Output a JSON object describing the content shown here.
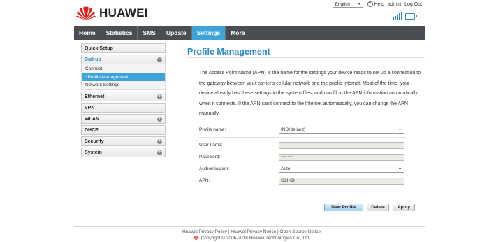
{
  "brand": {
    "name": "HUAWEI",
    "accent": "#2a8bc7",
    "nav_active": "#3ea3d8",
    "logo_color": "#e02020"
  },
  "toplinks": {
    "language": "English",
    "help": "Help",
    "user": "admin",
    "logout": "Log Out"
  },
  "nav": [
    {
      "label": "Home"
    },
    {
      "label": "Statistics"
    },
    {
      "label": "SMS"
    },
    {
      "label": "Update"
    },
    {
      "label": "Settings",
      "active": true
    },
    {
      "label": "More"
    }
  ],
  "sidebar": {
    "quick_setup": "Quick Setup",
    "dialup": "Dial-up",
    "dialup_items": [
      "Connect",
      "Profile Management",
      "Network Settings"
    ],
    "ethernet": "Ethernet",
    "vpn": "VPN",
    "wlan": "WLAN",
    "dhcp": "DHCP",
    "security": "Security",
    "system": "System"
  },
  "main": {
    "title": "Profile Management",
    "description": "The Access Point Name (APN) is the name for the settings your device reads to set up a connection to the gateway between your carrier's cellular network and the public Internet. Most of the time, your device already has these settings in the system files, and can fill in the APN information automatically when it connects. If the APN can't connect to the Internet automatically, you can change the APN manually.",
    "profile_label": "Profile name:",
    "profile_value": "IND(default)",
    "username_label": "User name:",
    "username_value": "",
    "password_label": "Password:",
    "password_value": "••••••••",
    "auth_label": "Authentication:",
    "auth_value": "Auto",
    "apn_label": "APN:",
    "apn_value": "O2IND",
    "btn_new": "New Profile",
    "btn_delete": "Delete",
    "btn_apply": "Apply"
  },
  "footer": {
    "links": "Huawei Privacy Policy | Huawei Privacy Notice | Open Source Notice",
    "copyright": "Copyright © 2006-2018 Huawei Technologies Co., Ltd."
  }
}
